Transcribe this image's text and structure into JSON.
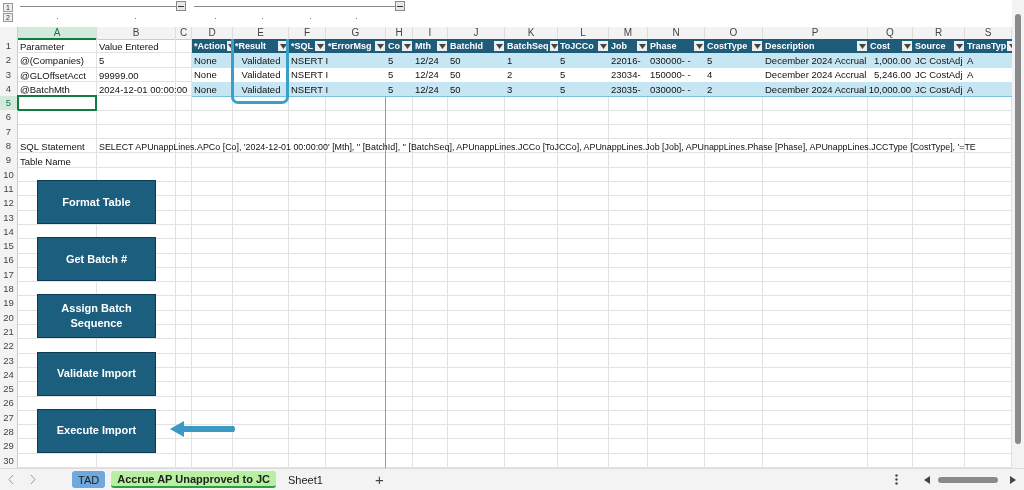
{
  "outline_levels": [
    "1",
    "2"
  ],
  "column_letters": [
    {
      "label": "A",
      "selected": true
    },
    {
      "label": "B",
      "selected": false
    },
    {
      "label": "C",
      "selected": false
    },
    {
      "label": "D",
      "selected": false
    },
    {
      "label": "E",
      "selected": false
    },
    {
      "label": "F",
      "selected": false
    },
    {
      "label": "G",
      "selected": false
    },
    {
      "label": "H",
      "selected": false
    },
    {
      "label": "I",
      "selected": false
    },
    {
      "label": "J",
      "selected": false
    },
    {
      "label": "K",
      "selected": false
    },
    {
      "label": "L",
      "selected": false
    },
    {
      "label": "M",
      "selected": false
    },
    {
      "label": "N",
      "selected": false
    },
    {
      "label": "O",
      "selected": false
    },
    {
      "label": "P",
      "selected": false
    },
    {
      "label": "Q",
      "selected": false
    },
    {
      "label": "R",
      "selected": false
    },
    {
      "label": "S",
      "selected": false
    }
  ],
  "row_numbers": [
    {
      "label": "1",
      "selected": false
    },
    {
      "label": "2",
      "selected": false
    },
    {
      "label": "3",
      "selected": false
    },
    {
      "label": "4",
      "selected": false
    },
    {
      "label": "5",
      "selected": true
    },
    {
      "label": "6",
      "selected": false
    },
    {
      "label": "7",
      "selected": false
    },
    {
      "label": "8",
      "selected": false
    },
    {
      "label": "9",
      "selected": false
    },
    {
      "label": "10",
      "selected": false
    },
    {
      "label": "11",
      "selected": false
    },
    {
      "label": "12",
      "selected": false
    },
    {
      "label": "13",
      "selected": false
    },
    {
      "label": "14",
      "selected": false
    },
    {
      "label": "15",
      "selected": false
    },
    {
      "label": "16",
      "selected": false
    },
    {
      "label": "17",
      "selected": false
    },
    {
      "label": "18",
      "selected": false
    },
    {
      "label": "19",
      "selected": false
    },
    {
      "label": "20",
      "selected": false
    },
    {
      "label": "21",
      "selected": false
    },
    {
      "label": "22",
      "selected": false
    },
    {
      "label": "23",
      "selected": false
    },
    {
      "label": "24",
      "selected": false
    },
    {
      "label": "25",
      "selected": false
    },
    {
      "label": "26",
      "selected": false
    },
    {
      "label": "27",
      "selected": false
    },
    {
      "label": "28",
      "selected": false
    },
    {
      "label": "29",
      "selected": false
    },
    {
      "label": "30",
      "selected": false
    }
  ],
  "parameters": [
    {
      "name": "Parameter",
      "value": "Value Entered"
    },
    {
      "name": "@(Companies)",
      "value": "5"
    },
    {
      "name": "@GLOffsetAcct",
      "value": "99999.00"
    },
    {
      "name": "@BatchMth",
      "value": "2024-12-01 00:00:00"
    }
  ],
  "table": {
    "columns": [
      {
        "label": "*Action",
        "highlighted": false
      },
      {
        "label": "*Result",
        "highlighted": true
      },
      {
        "label": "*SQL",
        "highlighted": false
      },
      {
        "label": "*ErrorMsg",
        "highlighted": false
      },
      {
        "label": "Co",
        "highlighted": false
      },
      {
        "label": "Mth",
        "highlighted": false
      },
      {
        "label": "BatchId",
        "highlighted": false
      },
      {
        "label": "BatchSeq",
        "highlighted": false
      },
      {
        "label": "ToJCCo",
        "highlighted": false
      },
      {
        "label": "Job",
        "highlighted": false
      },
      {
        "label": "Phase",
        "highlighted": false
      },
      {
        "label": "CostType",
        "highlighted": false
      },
      {
        "label": "Description",
        "highlighted": false
      },
      {
        "label": "Cost",
        "highlighted": false
      },
      {
        "label": "Source",
        "highlighted": false
      },
      {
        "label": "TransTyp",
        "highlighted": false
      }
    ],
    "rows": [
      [
        "None",
        "Validated",
        "NSERT I",
        null,
        "5",
        "12/24",
        "50",
        "1",
        "5",
        "22016-",
        "030000-  -",
        "5",
        "December 2024 Accrual",
        "1,000.00",
        "JC CostAdj",
        "A"
      ],
      [
        "None",
        "Validated",
        "NSERT I",
        null,
        "5",
        "12/24",
        "50",
        "2",
        "5",
        "23034-",
        "150000-  -",
        "4",
        "December 2024 Accrual",
        "5,246.00",
        "JC CostAdj",
        "A"
      ],
      [
        "None",
        "Validated",
        "NSERT I",
        null,
        "5",
        "12/24",
        "50",
        "3",
        "5",
        "23035-",
        "030000-  -",
        "2",
        "December 2024 Accrual",
        "10,000.00",
        "JC CostAdj",
        "A"
      ]
    ]
  },
  "sql_statement": {
    "label": "SQL Statement",
    "value": "SELECT APUnappLines.APCo [Co], '2024-12-01 00:00:00' [Mth], '' [BatchId], '' [BatchSeq], APUnappLines.JCCo [ToJCCo], APUnappLines.Job [Job], APUnappLines.Phase [Phase], APUnappLines.JCCType [CostType], '=TE"
  },
  "table_name": {
    "label": "Table Name"
  },
  "buttons": [
    "Format Table",
    "Get Batch #",
    "Assign Batch Sequence",
    "Validate Import",
    "Execute Import"
  ],
  "pointer_arrow": true,
  "sheet_tabs": [
    {
      "label": "TAD",
      "selected": false,
      "color": "#6fa8dc"
    },
    {
      "label": "Accrue AP Unapproved to JC",
      "selected": true,
      "color": "#b6f0a0"
    },
    {
      "label": "Sheet1",
      "selected": false
    }
  ],
  "add_sheet": "+"
}
